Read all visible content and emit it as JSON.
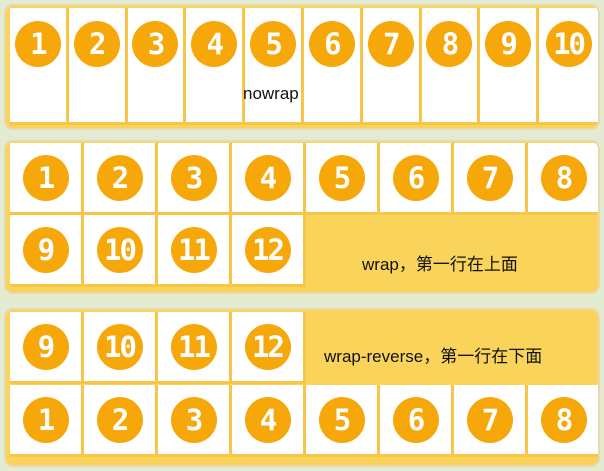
{
  "panels": {
    "nowrap": {
      "caption": "nowrap",
      "items": [
        "1",
        "2",
        "3",
        "4",
        "5",
        "6",
        "7",
        "8",
        "9",
        "10"
      ]
    },
    "wrap": {
      "caption": "wrap，第一行在上面",
      "first_row": [
        "1",
        "2",
        "3",
        "4",
        "5",
        "6",
        "7",
        "8"
      ],
      "second_row": [
        "9",
        "10",
        "11",
        "12"
      ]
    },
    "wrap_reverse": {
      "caption": "wrap-reverse，第一行在下面",
      "top_row": [
        "9",
        "10",
        "11",
        "12"
      ],
      "bottom_row": [
        "1",
        "2",
        "3",
        "4",
        "5",
        "6",
        "7",
        "8"
      ]
    }
  },
  "colors": {
    "container": "#f9d35a",
    "badge": "#f6a80a",
    "cell": "#ffffff",
    "background": "#e3ebd3"
  }
}
